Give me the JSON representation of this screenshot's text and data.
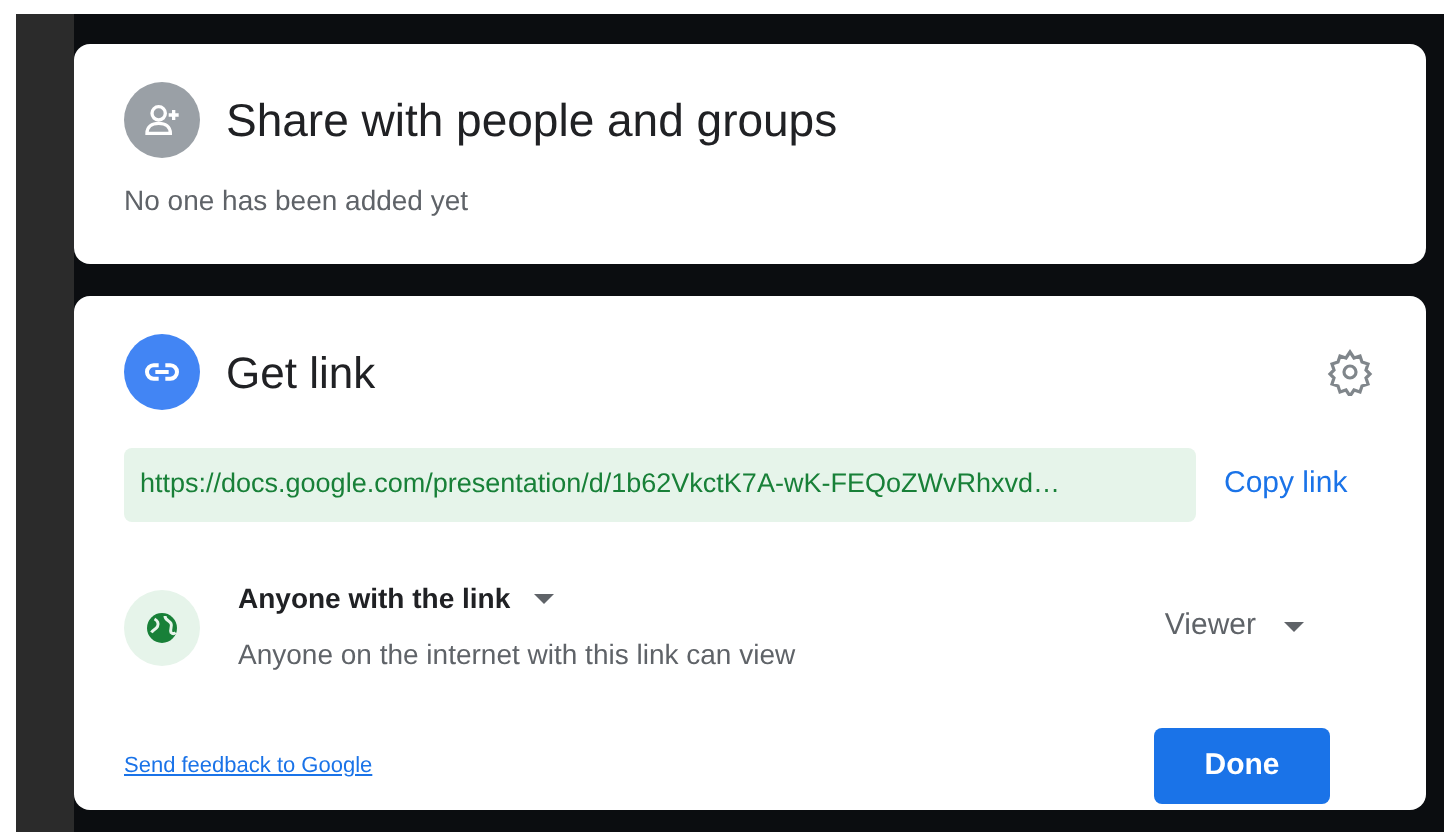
{
  "share": {
    "title": "Share with people and groups",
    "subtitle": "No one has been added yet"
  },
  "get_link": {
    "title": "Get link",
    "url": "https://docs.google.com/presentation/d/1b62VkctK7A-wK-FEQoZWvRhxvd…",
    "copy_label": "Copy link"
  },
  "access": {
    "scope": "Anyone with the link",
    "description": "Anyone on the internet with this link can view",
    "role": "Viewer"
  },
  "feedback_link": "Send feedback to Google",
  "done_button": "Done"
}
